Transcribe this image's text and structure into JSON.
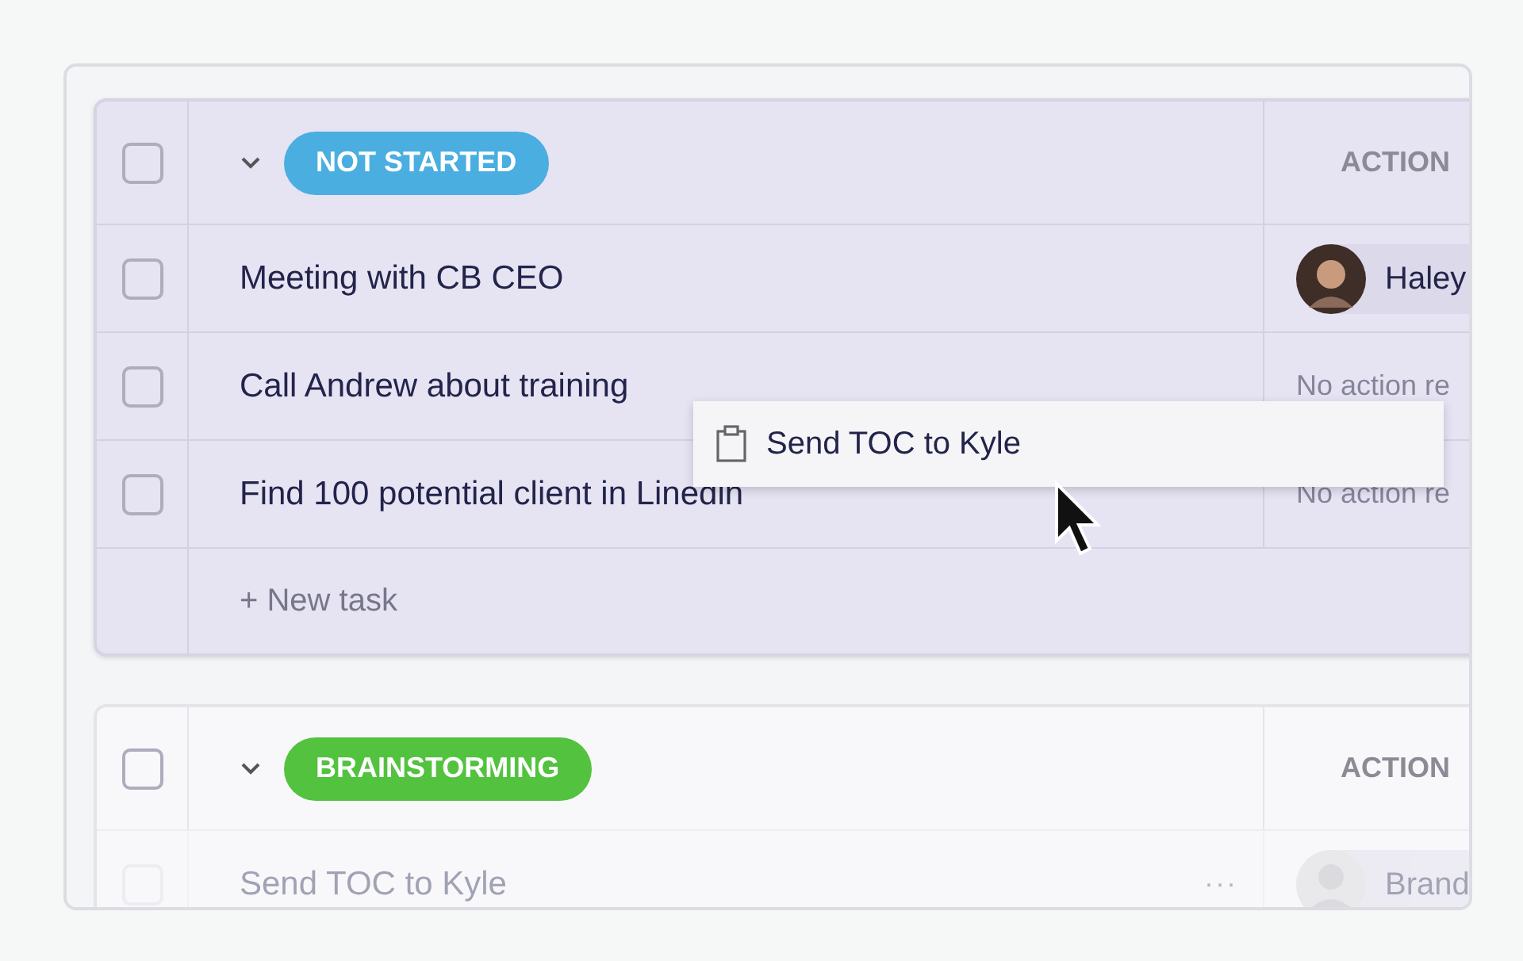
{
  "groups": [
    {
      "status": "NOT STARTED",
      "color": "#4aaee0",
      "expanded": true,
      "column_header": "ACTION",
      "all_checked": false,
      "new_task": "+ New task",
      "dimmed": false,
      "rows": [
        {
          "title": "Meeting with CB CEO",
          "checked": false,
          "dragging": false,
          "action": {
            "kind": "person",
            "name": "Haley"
          }
        },
        {
          "title": "Call Andrew about training",
          "checked": false,
          "dragging": false,
          "action": {
            "kind": "text",
            "text": "No action re"
          }
        },
        {
          "title": "Find 100 potential client in Linedin",
          "checked": false,
          "dragging": false,
          "action": {
            "kind": "text",
            "text": "No action re"
          }
        }
      ]
    },
    {
      "status": "BRAINSTORMING",
      "color": "#52c23f",
      "expanded": true,
      "column_header": "ACTION",
      "all_checked": false,
      "dimmed": true,
      "rows": [
        {
          "title": "Send TOC to Kyle",
          "checked": false,
          "dragging": true,
          "more": "···",
          "action": {
            "kind": "person",
            "name": "Brand"
          }
        }
      ]
    }
  ],
  "drag_preview": {
    "title": "Send TOC to Kyle"
  }
}
